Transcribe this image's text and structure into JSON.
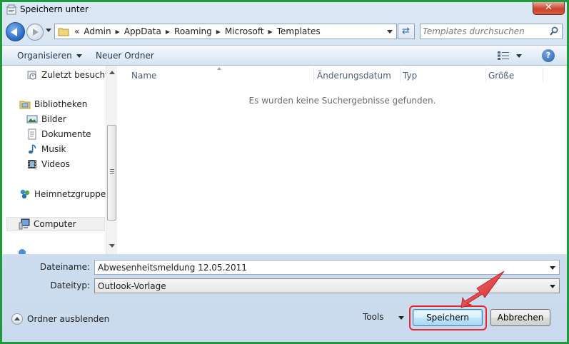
{
  "window": {
    "title": "Speichern unter",
    "close_label": "✕"
  },
  "address_bar": {
    "overflow_marker": "«",
    "crumbs": [
      "Admin",
      "AppData",
      "Roaming",
      "Microsoft",
      "Templates"
    ]
  },
  "search": {
    "placeholder": "Templates durchsuchen"
  },
  "toolbar": {
    "organize_label": "Organisieren",
    "new_folder_label": "Neuer Ordner",
    "help_label": "?"
  },
  "nav_pane": {
    "items": [
      {
        "label": "Zuletzt besucht",
        "icon": "recent-places-icon"
      },
      {
        "label": "Bibliotheken",
        "icon": "libraries-icon"
      },
      {
        "label": "Bilder",
        "icon": "pictures-icon"
      },
      {
        "label": "Dokumente",
        "icon": "documents-icon"
      },
      {
        "label": "Musik",
        "icon": "music-icon"
      },
      {
        "label": "Videos",
        "icon": "videos-icon"
      },
      {
        "label": "Heimnetzgruppe",
        "icon": "homegroup-icon"
      },
      {
        "label": "Computer",
        "icon": "computer-icon",
        "selected": true
      }
    ]
  },
  "file_list": {
    "columns": [
      "Name",
      "Änderungsdatum",
      "Typ",
      "Größe"
    ],
    "empty_message": "Es wurden keine Suchergebnisse gefunden."
  },
  "form": {
    "filename_label": "Dateiname:",
    "filename_value": "Abwesenheitsmeldung 12.05.2011",
    "filetype_label": "Dateityp:",
    "filetype_value": "Outlook-Vorlage"
  },
  "footer": {
    "hide_folders_label": "Ordner ausblenden",
    "tools_label": "Tools",
    "save_label": "Speichern",
    "cancel_label": "Abbrechen"
  },
  "colors": {
    "frame_border": "#1e9a3a",
    "annotation_red": "#e8262a"
  }
}
